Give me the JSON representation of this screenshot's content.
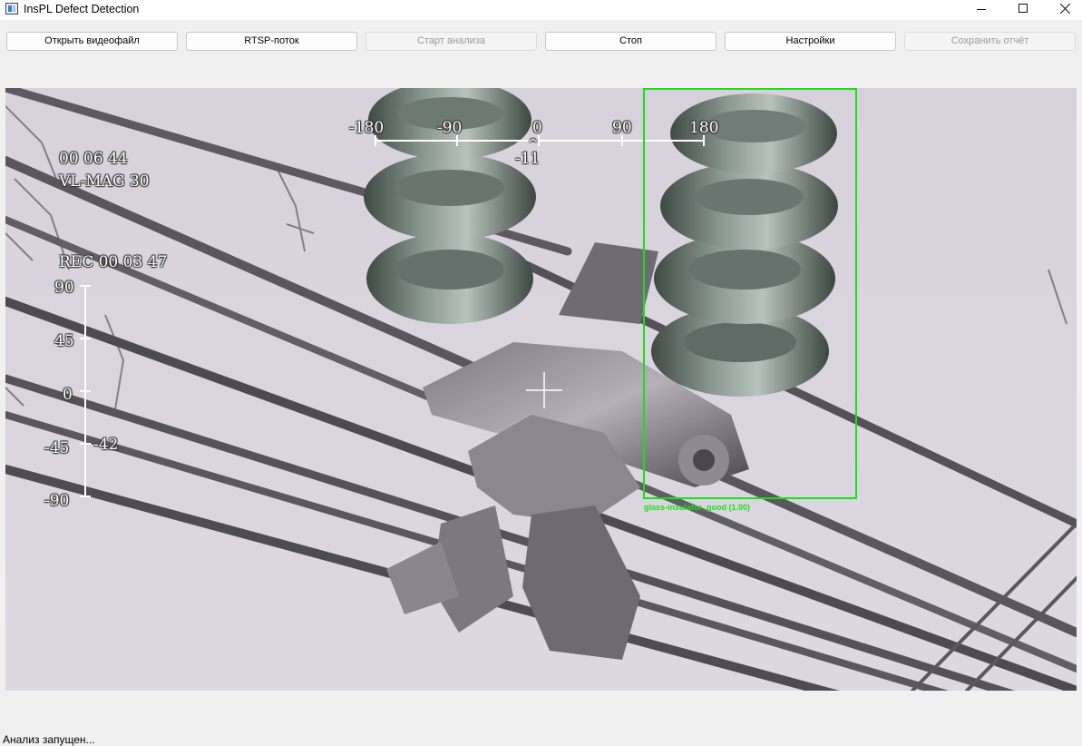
{
  "window": {
    "title": "InsPL Defect Detection",
    "app_icon": "app-icon",
    "controls": [
      "minimize-icon",
      "maximize-icon",
      "close-icon"
    ]
  },
  "toolbar": {
    "open_file": "Открыть видеофайл",
    "rtsp": "RTSP-поток",
    "start": "Старт анализа",
    "stop": "Стоп",
    "settings": "Настройки",
    "save_report": "Сохранить отчёт"
  },
  "video": {
    "osd": {
      "time": "00 06 44",
      "mag": "VL-MAG 30",
      "rec": "REC 00 03 47",
      "pan_ticks": [
        "-180",
        "-90",
        "0",
        "90",
        "180"
      ],
      "pan_value": "-11",
      "pan_caret": "^",
      "tilt_ticks": [
        "90",
        "45",
        "0",
        "-45",
        "-90"
      ],
      "tilt_value": "-42"
    },
    "detection": {
      "label": "glass-insulator_good (1.00)",
      "box_color": "#19e019"
    }
  },
  "status": {
    "text": "Анализ запущен..."
  },
  "colors": {
    "window_bg": "#f0f0f0",
    "sky": "#d9d4dd",
    "detection_green": "#19e019"
  }
}
